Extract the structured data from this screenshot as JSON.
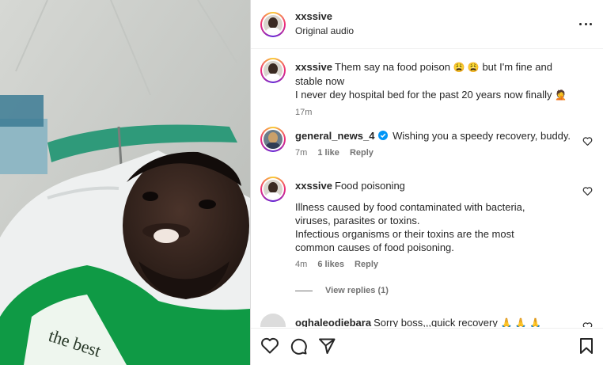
{
  "post": {
    "username": "xxssive",
    "audio": "Original audio"
  },
  "icons": {
    "more": "more-horizontal-icon",
    "like": "heart-icon",
    "comment": "comment-icon",
    "share": "send-icon",
    "save": "bookmark-icon",
    "verified": "verified-badge-icon"
  },
  "colors": {
    "verified": "#0095f6",
    "text": "#262626",
    "secondary": "#737373",
    "shirt": "#0f9a45"
  },
  "comments": [
    {
      "username": "xxssive",
      "line1": "Them say na food poison",
      "emoji1": "😩 😩",
      "line1b": " but I'm fine and stable now",
      "line2": "I never dey hospital bed for the past 20 years now finally",
      "emoji2": "🤦",
      "time": "17m"
    },
    {
      "username": "general_news_4",
      "text": "Wishing you a speedy recovery, buddy.",
      "time": "7m",
      "likes": "1 like",
      "reply": "Reply"
    },
    {
      "username": "xxssive",
      "text": "Food poisoning",
      "p1": "Illness caused by food contaminated with bacteria, viruses, parasites or toxins.",
      "p2": "Infectious organisms or their toxins are the most common causes of food poisoning.",
      "time": "4m",
      "likes": "6 likes",
      "reply": "Reply",
      "view_replies": "View replies (1)"
    },
    {
      "username": "oghaleodiebara",
      "text": "Sorry boss,,,quick recovery",
      "emoji": "🙏 🙏 🙏"
    }
  ],
  "media": {
    "shirt_text": "the best"
  }
}
